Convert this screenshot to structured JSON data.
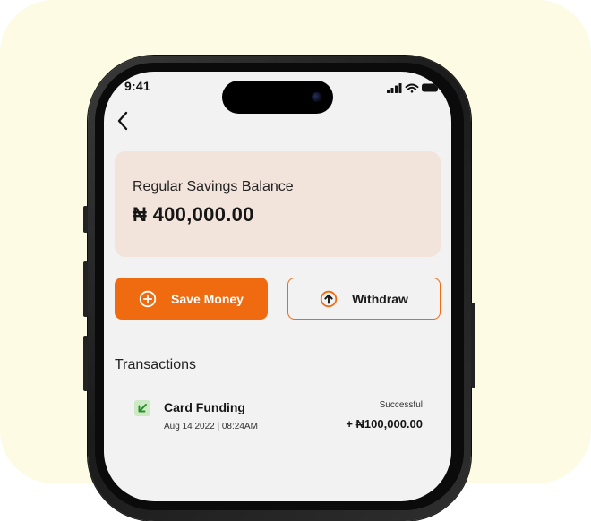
{
  "status_bar": {
    "time": "9:41",
    "icons": [
      "cellular-signal-icon",
      "wifi-icon",
      "battery-icon"
    ]
  },
  "nav": {
    "back_icon": "chevron-left-icon"
  },
  "balance": {
    "label": "Regular Savings Balance",
    "amount": "₦ 400,000.00"
  },
  "actions": {
    "save_label": "Save Money",
    "save_icon": "plus-circle-icon",
    "withdraw_label": "Withdraw",
    "withdraw_icon": "arrow-up-circle-icon"
  },
  "transactions": {
    "title": "Transactions",
    "items": [
      {
        "name": "Card Funding",
        "date": "Aug 14 2022 | 08:24AM",
        "status": "Successful",
        "amount": "+ ₦100,000.00",
        "icon": "arrow-down-left-icon"
      }
    ]
  },
  "colors": {
    "accent": "#f06a0f",
    "card_bg": "#f2e4db",
    "screen_bg": "#f2f2f2",
    "page_bg": "#fdfbe3",
    "funding_icon_bg": "#cdeac4",
    "funding_icon_fg": "#2e8b2e"
  }
}
